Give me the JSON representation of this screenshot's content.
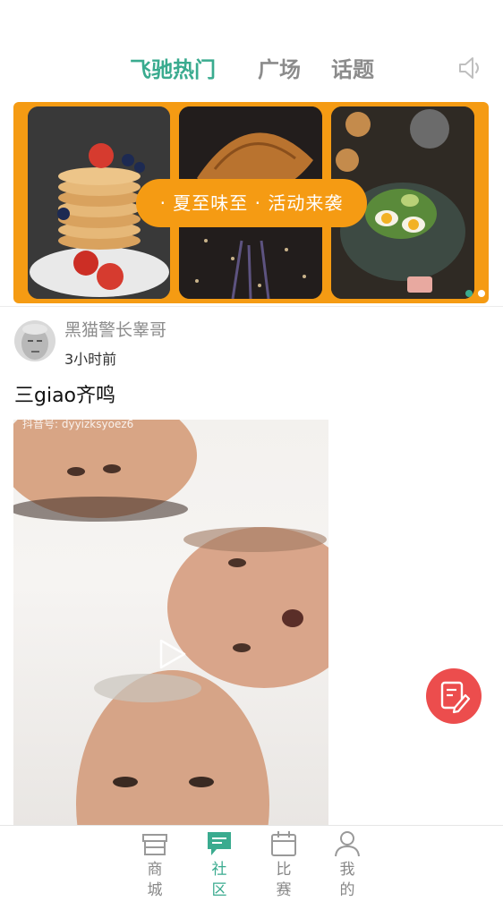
{
  "header": {
    "tabs": [
      {
        "label": "飞驰热门",
        "active": true
      },
      {
        "label": "广场",
        "active": false
      },
      {
        "label": "话题",
        "active": false
      }
    ],
    "speaker_icon": "speaker-icon"
  },
  "banner": {
    "text": "· 夏至味至 · 活动来袭",
    "background_color": "#f59b13",
    "slides_total": 2,
    "active_slide": 1
  },
  "post": {
    "username": "黑猫警长睾哥",
    "time": "3小时前",
    "title": "三giao齐鸣",
    "video": {
      "watermark": "抖音号: dyyizksyoez6",
      "play_icon": "play-icon"
    }
  },
  "fab": {
    "icon": "edit-icon",
    "color": "#ec4d4d"
  },
  "bottom_nav": {
    "items": [
      {
        "label": "商城",
        "icon": "store-icon",
        "active": false
      },
      {
        "label": "社区",
        "icon": "community-icon",
        "active": true
      },
      {
        "label": "比赛",
        "icon": "calendar-icon",
        "active": false
      },
      {
        "label": "我的",
        "icon": "user-icon",
        "active": false
      }
    ]
  },
  "colors": {
    "accent": "#3aab8f",
    "inactive": "#8c8c8c"
  }
}
